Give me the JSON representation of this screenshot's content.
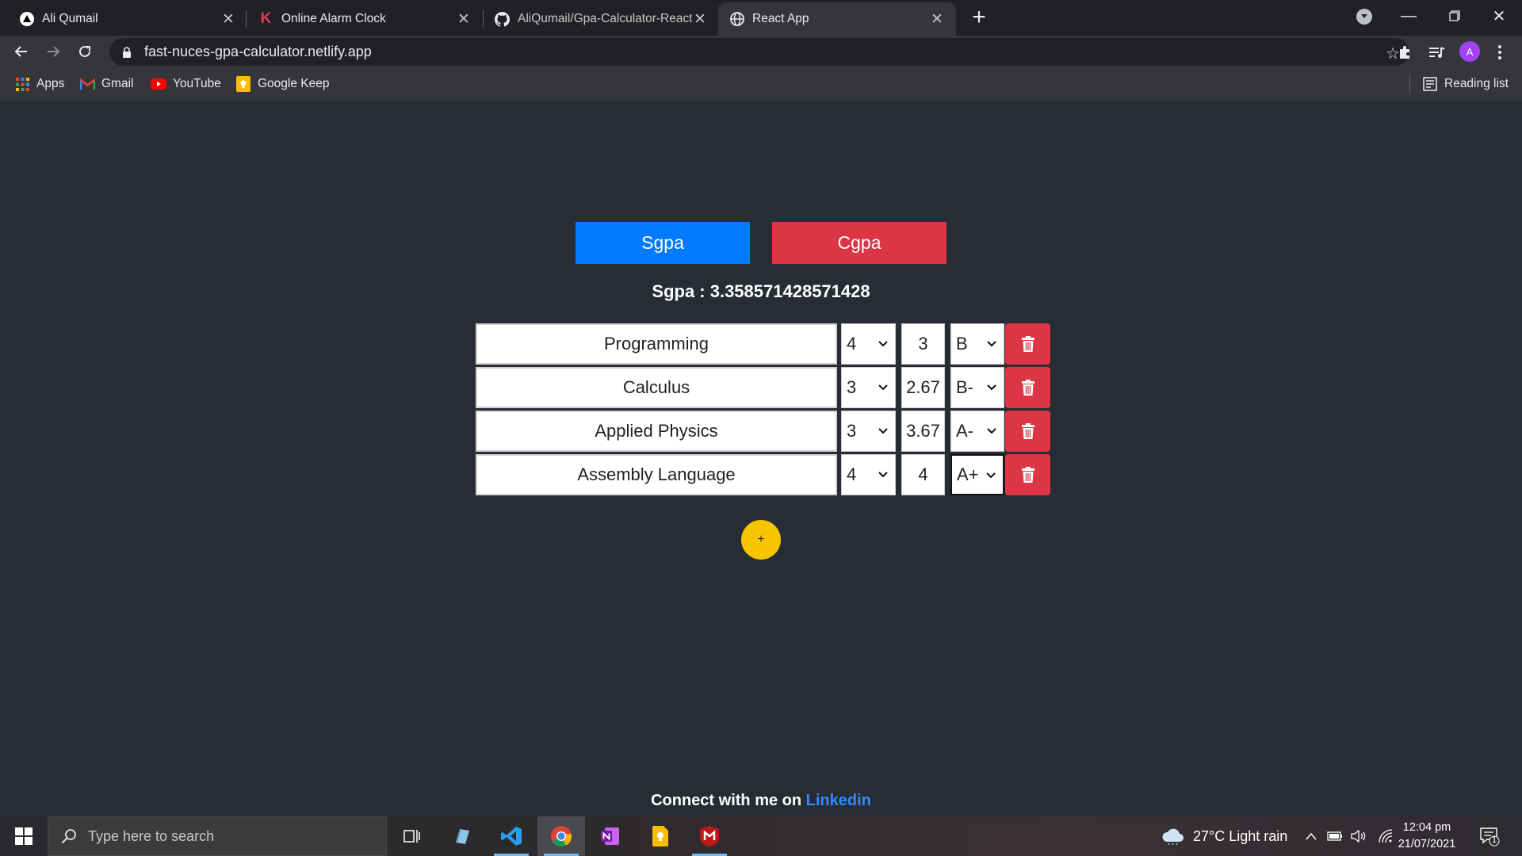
{
  "browser": {
    "tabs": [
      {
        "title": "Ali Qumail",
        "icon": "vercel-triangle-icon"
      },
      {
        "title": "Online Alarm Clock",
        "icon": "k-logo-icon"
      },
      {
        "title": "AliQumail/Gpa-Calculator-React-",
        "icon": "github-icon"
      },
      {
        "title": "React App",
        "icon": "globe-icon",
        "active": true
      }
    ],
    "url": "fast-nuces-gpa-calculator.netlify.app",
    "avatar_letter": "A",
    "bookmarks": [
      "Apps",
      "Gmail",
      "YouTube",
      "Google Keep"
    ],
    "reading_list": "Reading list"
  },
  "app": {
    "sgpa_button": "Sgpa",
    "cgpa_button": "Cgpa",
    "result": "Sgpa : 3.358571428571428",
    "courses": [
      {
        "name": "Programming",
        "credits": "4",
        "points": "3",
        "grade": "B"
      },
      {
        "name": "Calculus",
        "credits": "3",
        "points": "2.67",
        "grade": "B-"
      },
      {
        "name": "Applied Physics",
        "credits": "3",
        "points": "3.67",
        "grade": "A-"
      },
      {
        "name": "Assembly Language",
        "credits": "4",
        "points": "4",
        "grade": "A+"
      }
    ],
    "add_button": "+",
    "footer_text": "Connect with me on",
    "footer_link": "Linkedin",
    "colors": {
      "primary": "#007bff",
      "danger": "#dc3545",
      "warning": "#f7c400",
      "background": "#282c34"
    }
  },
  "taskbar": {
    "search_placeholder": "Type here to search",
    "weather": "27°C  Light rain",
    "time": "12:04 pm",
    "date": "21/07/2021",
    "notification_count": "1"
  }
}
